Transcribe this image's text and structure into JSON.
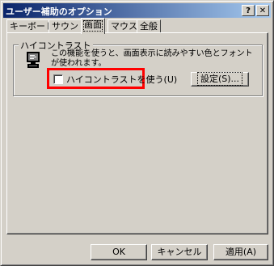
{
  "window": {
    "title": "ユーザー補助のオプション",
    "help_glyph": "?",
    "close_glyph": "✕"
  },
  "tabs": [
    {
      "label": "キーボード",
      "active": false
    },
    {
      "label": "サウンド",
      "active": false
    },
    {
      "label": "画面",
      "active": true
    },
    {
      "label": "マウス",
      "active": false
    },
    {
      "label": "全般",
      "active": false
    }
  ],
  "high_contrast": {
    "group_title": "ハイコントラスト",
    "icon": "high-contrast-monitor-icon",
    "description": "この機能を使うと、画面表示に読みやすい色とフォントが使われます。",
    "checkbox_label": "ハイコントラストを使う(U)",
    "checked": false,
    "settings_button": "設定(S)..."
  },
  "footer": {
    "ok": "OK",
    "cancel": "キャンセル",
    "apply": "適用(A)"
  },
  "colors": {
    "face": "#d4d0c8",
    "title_start": "#0a246a",
    "title_end": "#a6caf0",
    "highlight": "#ff0000"
  }
}
